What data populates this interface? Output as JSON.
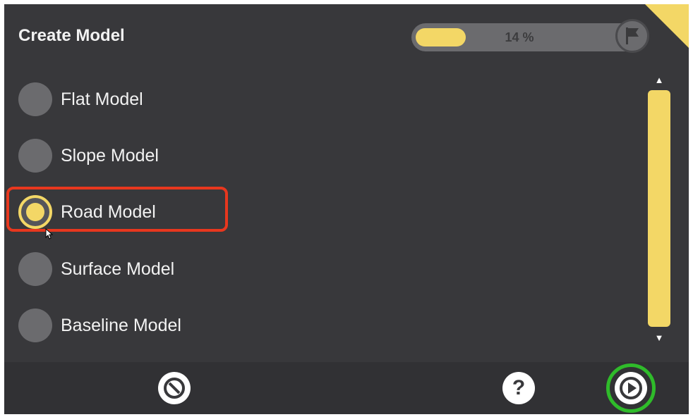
{
  "header": {
    "title": "Create Model",
    "progress_text": "14 %",
    "progress_value": 0.14
  },
  "options": [
    {
      "label": "Flat Model",
      "selected": false
    },
    {
      "label": "Slope Model",
      "selected": false
    },
    {
      "label": "Road Model",
      "selected": true
    },
    {
      "label": "Surface Model",
      "selected": false
    },
    {
      "label": "Baseline Model",
      "selected": false
    }
  ],
  "scroll": {
    "up_glyph": "▲",
    "down_glyph": "▼"
  },
  "footer": {
    "cancel_icon": "cancel-icon",
    "help_label": "?",
    "next_icon": "play-icon"
  },
  "colors": {
    "accent": "#f3d766",
    "background": "#38383b",
    "highlight_red": "#e8371e",
    "highlight_green": "#2fbb2a"
  }
}
